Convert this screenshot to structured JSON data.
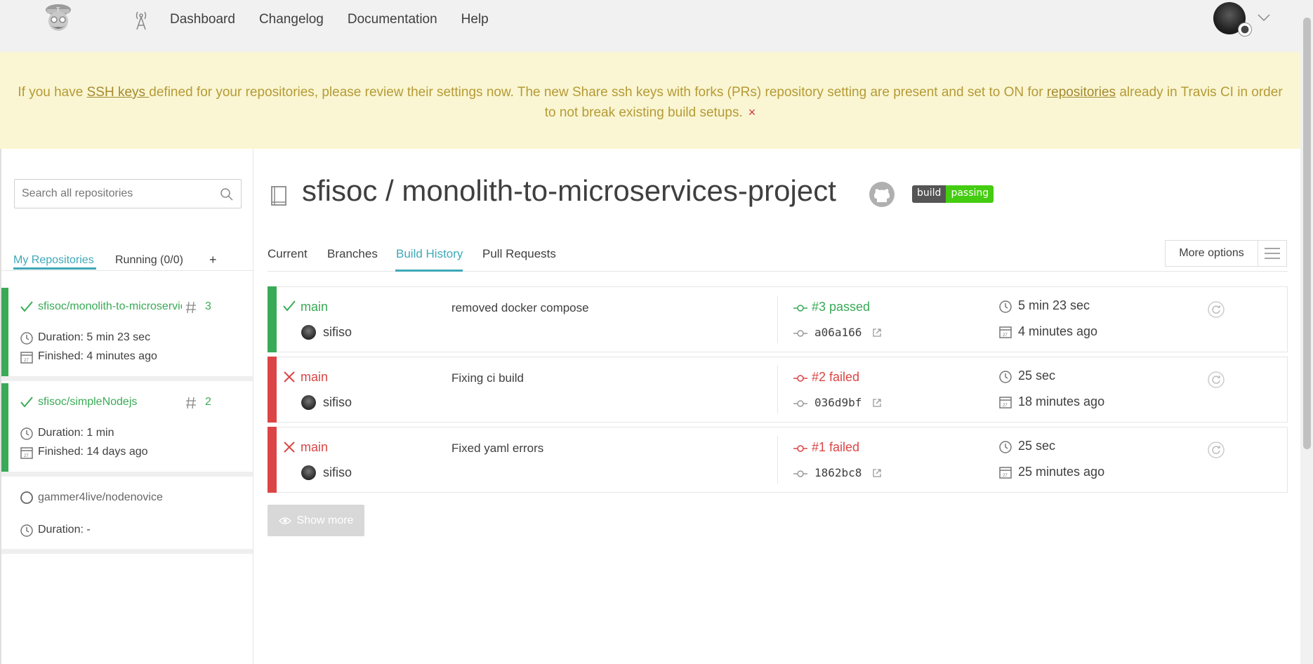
{
  "nav": {
    "links": [
      "Dashboard",
      "Changelog",
      "Documentation",
      "Help"
    ]
  },
  "banner": {
    "text_before": "If you have ",
    "link1": "SSH keys ",
    "text_middle": "defined for your repositories, please review their settings now. The new Share ssh keys with forks (PRs) repository setting are present and set to ON for ",
    "link2": "repositories",
    "text_after": " already in Travis CI in order to not break existing build setups.",
    "close": "×"
  },
  "sidebar": {
    "search_placeholder": "Search all repositories",
    "tabs": [
      "My Repositories",
      "Running (0/0)",
      "+"
    ],
    "repos": [
      {
        "name": "sfisoc/monolith-to-microservices-project",
        "number": "3",
        "duration": "Duration: 5 min 23 sec",
        "finished": "Finished: 4 minutes ago"
      },
      {
        "name": "sfisoc/simpleNodejs",
        "number": "2",
        "duration": "Duration: 1 min",
        "finished": "Finished: 14 days ago"
      },
      {
        "name": "gammer4live/nodenovice",
        "duration": "Duration: -"
      }
    ]
  },
  "main": {
    "title": "sfisoc / monolith-to-microservices-project",
    "badge_left": "build",
    "badge_right": "passing",
    "tabs": [
      "Current",
      "Branches",
      "Build History",
      "Pull Requests"
    ],
    "more_options": "More options",
    "builds": [
      {
        "branch": "main",
        "author": "sifiso",
        "message": "removed docker compose",
        "state": "#3 passed",
        "hash": "a06a166",
        "duration": "5 min 23 sec",
        "when": "4 minutes ago",
        "status": "pass"
      },
      {
        "branch": "main",
        "author": "sifiso",
        "message": "Fixing ci build",
        "state": "#2 failed",
        "hash": "036d9bf",
        "duration": "25 sec",
        "when": "18 minutes ago",
        "status": "fail"
      },
      {
        "branch": "main",
        "author": "sifiso",
        "message": "Fixed yaml errors",
        "state": "#1 failed",
        "hash": "1862bc8",
        "duration": "25 sec",
        "when": "25 minutes ago",
        "status": "fail"
      }
    ],
    "show_more": "Show more"
  },
  "colors": {
    "accent": "#3ea8b8",
    "pass": "#39aa56",
    "fail": "#db4545",
    "banner_bg": "#faf6d3",
    "banner_text": "#b59a36"
  }
}
